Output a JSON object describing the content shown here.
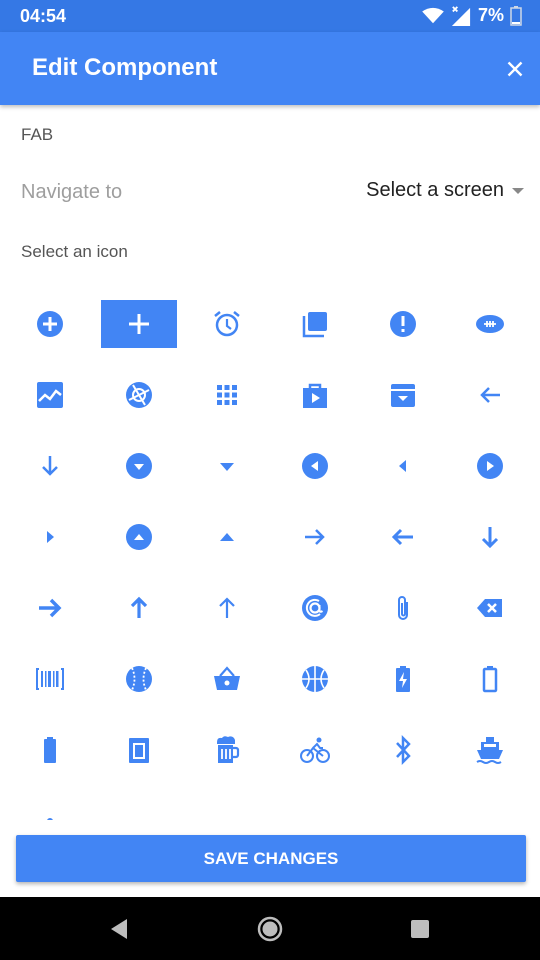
{
  "status": {
    "time": "04:54",
    "battery": "7%"
  },
  "appbar": {
    "title": "Edit Component"
  },
  "form": {
    "component_label": "FAB",
    "navigate_label": "Navigate to",
    "navigate_value": "Select a screen",
    "icon_label": "Select an icon"
  },
  "icons": [
    "add-circle-icon",
    "add-icon",
    "alarm-icon",
    "library-icon",
    "error-icon",
    "football-icon",
    "area-chart-icon",
    "camera-aperture-icon",
    "apps-icon",
    "shop-icon",
    "archive-icon",
    "arrow-back-icon",
    "arrow-downward-icon",
    "arrow-drop-down-circle-icon",
    "arrow-drop-down-icon",
    "arrow-left-circle-icon",
    "arrow-left-icon",
    "arrow-right-circle-icon",
    "arrow-right-icon",
    "arrow-drop-up-circle-icon",
    "arrow-drop-up-icon",
    "arrow-forward-icon",
    "arrow-back-thin-icon",
    "arrow-down-icon",
    "arrow-forward-thick-icon",
    "arrow-upward-icon",
    "arrow-up-thin-icon",
    "at-sign-icon",
    "attachment-icon",
    "backspace-icon",
    "barcode-icon",
    "baseball-icon",
    "basket-icon",
    "basketball-icon",
    "battery-charging-icon",
    "battery-empty-icon",
    "battery-full-icon",
    "beaker-icon",
    "beer-icon",
    "bicycle-icon",
    "bluetooth-icon",
    "boat-icon",
    "more-1-icon",
    "more-2-icon",
    "more-3-icon",
    "more-4-icon",
    "more-5-icon",
    "more-6-icon"
  ],
  "selected_icon_index": 1,
  "save_label": "SAVE CHANGES",
  "colors": {
    "primary": "#4285f4",
    "statusbar": "#3578e5",
    "icon": "#4285f4"
  }
}
